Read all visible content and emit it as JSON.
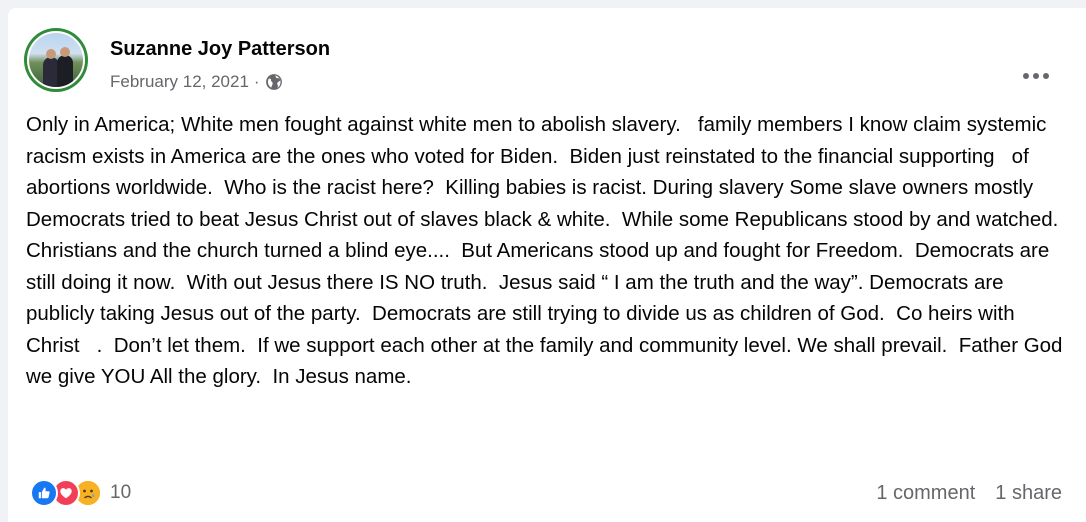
{
  "post": {
    "author": "Suzanne Joy Patterson",
    "date": "February 12, 2021",
    "separator": "·",
    "privacy_icon": "globe-icon",
    "more_icon": "more-options-icon",
    "text": "Only in America; White men fought against white men to abolish slavery.   family members I know claim systemic racism exists in America are the ones who voted for Biden.  Biden just reinstated to the financial supporting   of abortions worldwide.  Who is the racist here?  Killing babies is racist. During slavery Some slave owners mostly Democrats tried to beat Jesus Christ out of slaves black & white.  While some Republicans stood by and watched.  Christians and the church turned a blind eye....  But Americans stood up and fought for Freedom.  Democrats are still doing it now.  With out Jesus there IS NO truth.  Jesus said “ I am the truth and the way”. Democrats are publicly taking Jesus out of the party.  Democrats are still trying to divide us as children of God.  Co heirs with Christ   .  Don’t let them.  If we support each other at the family and community level. We shall prevail.  Father God we give YOU All the glory.  In Jesus name."
  },
  "footer": {
    "reactions": [
      "like-icon",
      "love-icon",
      "care-icon"
    ],
    "reaction_count": "10",
    "comments": "1 comment",
    "shares": "1 share"
  },
  "colors": {
    "like": "#1877f2",
    "love": "#f33e58",
    "care": "#f7b125",
    "secondary_text": "#65676b",
    "avatar_ring": "#2e8b3a"
  }
}
